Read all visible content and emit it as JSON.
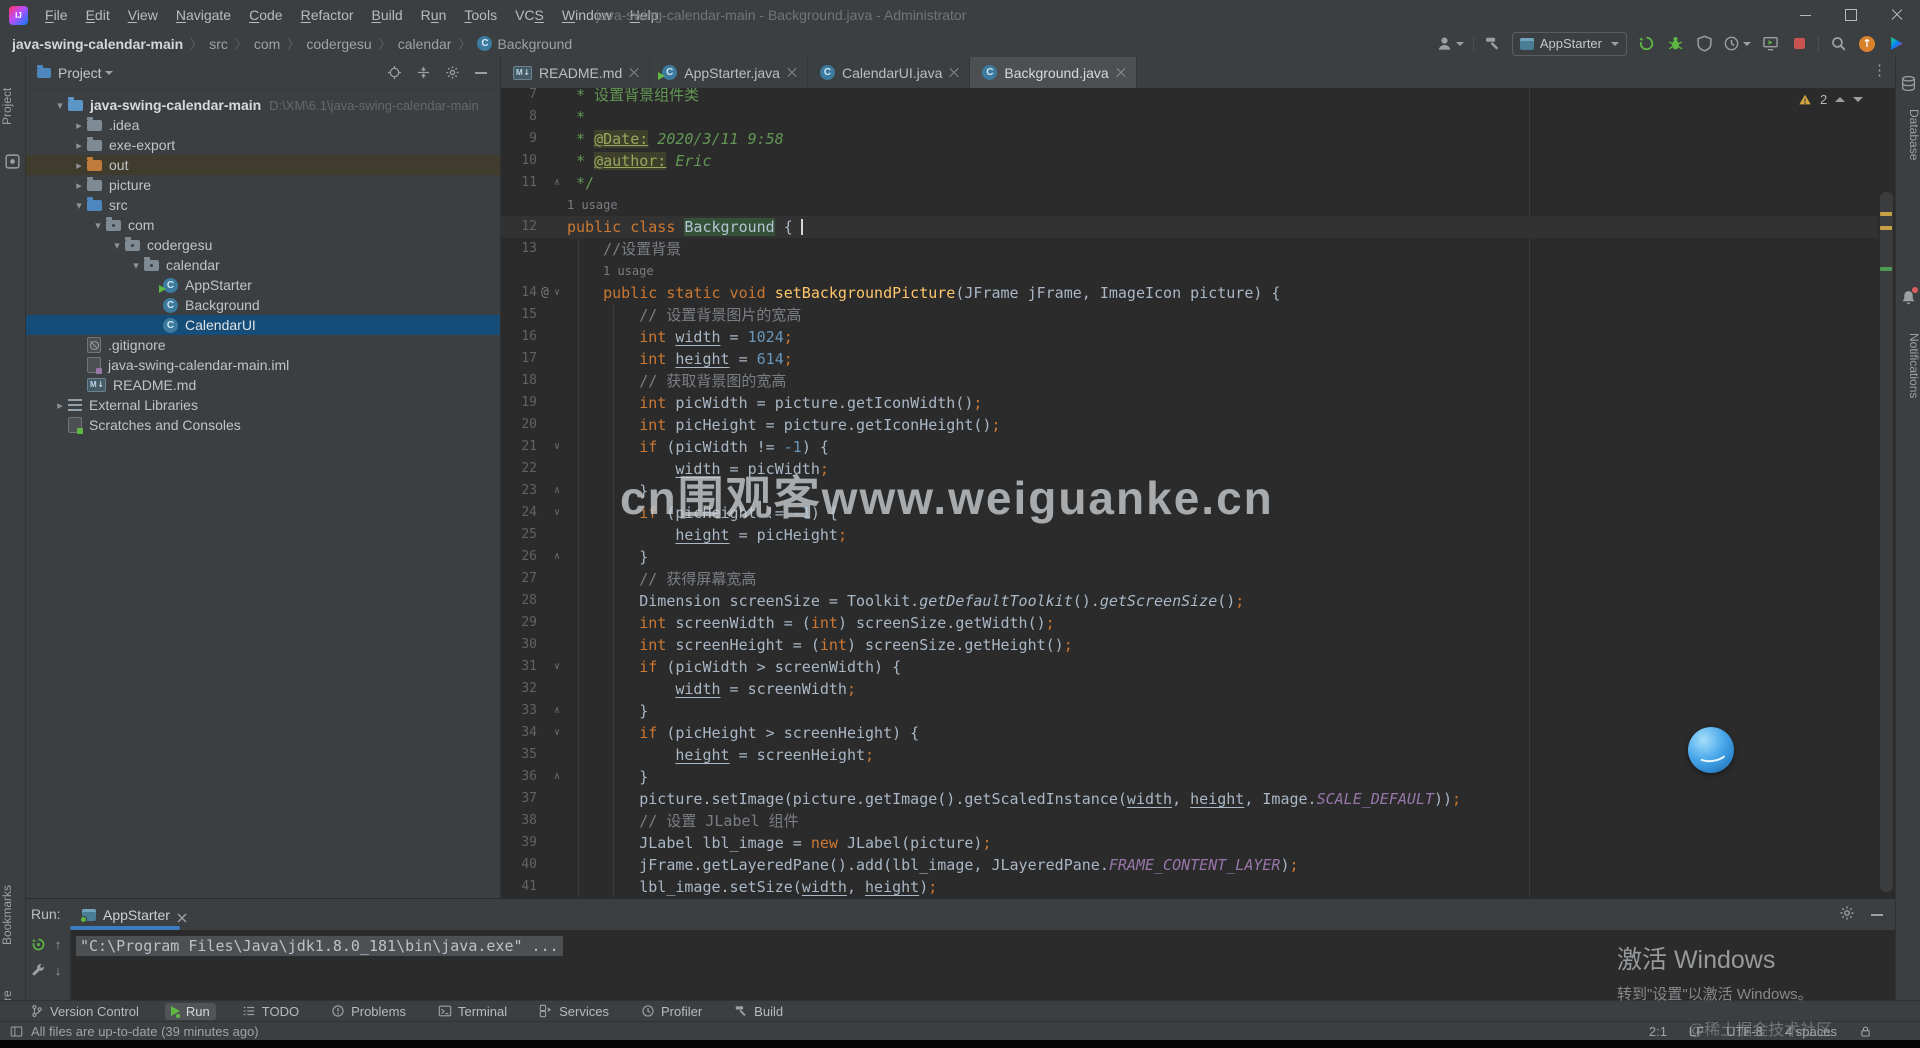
{
  "titlebar": {
    "logo": "IJ",
    "title": "java-swing-calendar-main - Background.java - Administrator",
    "menus": [
      {
        "label": "File",
        "m": 0
      },
      {
        "label": "Edit",
        "m": 0
      },
      {
        "label": "View",
        "m": 0
      },
      {
        "label": "Navigate",
        "m": 0
      },
      {
        "label": "Code",
        "m": 0
      },
      {
        "label": "Refactor",
        "m": 0
      },
      {
        "label": "Build",
        "m": 0
      },
      {
        "label": "Run",
        "m": 1
      },
      {
        "label": "Tools",
        "m": 0
      },
      {
        "label": "VCS",
        "m": 2
      },
      {
        "label": "Window",
        "m": 0
      },
      {
        "label": "Help",
        "m": 0
      }
    ]
  },
  "navbar": {
    "breadcrumb": [
      {
        "label": "java-swing-calendar-main",
        "bold": true
      },
      {
        "label": "src"
      },
      {
        "label": "com"
      },
      {
        "label": "codergesu"
      },
      {
        "label": "calendar"
      },
      {
        "label": "Background",
        "icon": "class"
      }
    ],
    "run_config": "AppStarter"
  },
  "project": {
    "header": "Project",
    "tree": [
      {
        "lvl": 0,
        "chev": "open",
        "icon": "folder-proj",
        "label": "java-swing-calendar-main",
        "extra": "D:\\XM\\6.1\\java-swing-calendar-main",
        "bold": true
      },
      {
        "lvl": 1,
        "chev": "closed",
        "icon": "folder",
        "label": ".idea"
      },
      {
        "lvl": 1,
        "chev": "closed",
        "icon": "folder",
        "label": "exe-export"
      },
      {
        "lvl": 1,
        "chev": "closed",
        "icon": "folder-excl",
        "label": "out",
        "hl": "mod"
      },
      {
        "lvl": 1,
        "chev": "closed",
        "icon": "folder",
        "label": "picture"
      },
      {
        "lvl": 1,
        "chev": "open",
        "icon": "folder-src",
        "label": "src"
      },
      {
        "lvl": 2,
        "chev": "open",
        "icon": "package",
        "label": "com"
      },
      {
        "lvl": 3,
        "chev": "open",
        "icon": "package",
        "label": "codergesu"
      },
      {
        "lvl": 4,
        "chev": "open",
        "icon": "package",
        "label": "calendar"
      },
      {
        "lvl": 5,
        "chev": "none",
        "icon": "class-run",
        "label": "AppStarter"
      },
      {
        "lvl": 5,
        "chev": "none",
        "icon": "class",
        "label": "Background"
      },
      {
        "lvl": 5,
        "chev": "none",
        "icon": "class",
        "label": "CalendarUI",
        "sel": true
      },
      {
        "lvl": 1,
        "chev": "none",
        "icon": "file-ign",
        "label": ".gitignore"
      },
      {
        "lvl": 1,
        "chev": "none",
        "icon": "file-iml",
        "label": "java-swing-calendar-main.iml"
      },
      {
        "lvl": 1,
        "chev": "none",
        "icon": "file-md",
        "label": "README.md"
      },
      {
        "lvl": 0,
        "chev": "closed",
        "icon": "lib",
        "label": "External Libraries"
      },
      {
        "lvl": 0,
        "chev": "none",
        "icon": "file-scr",
        "label": "Scratches and Consoles"
      }
    ]
  },
  "tabs": [
    {
      "label": "README.md",
      "icon": "file-md"
    },
    {
      "label": "AppStarter.java",
      "icon": "class-run"
    },
    {
      "label": "CalendarUI.java",
      "icon": "class"
    },
    {
      "label": "Background.java",
      "icon": "class",
      "active": true
    }
  ],
  "editor": {
    "inspections": "2",
    "lines": [
      {
        "n": "7",
        "seg": [
          [
            "dc",
            " * 设置背景组件类"
          ]
        ]
      },
      {
        "n": "8",
        "seg": [
          [
            "dc",
            " *"
          ]
        ]
      },
      {
        "n": "9",
        "seg": [
          [
            "dc",
            " * "
          ],
          [
            "tag",
            "@Date:"
          ],
          [
            "dci",
            " 2020/3/11 9:58"
          ]
        ]
      },
      {
        "n": "10",
        "seg": [
          [
            "dc",
            " * "
          ],
          [
            "tag",
            "@author:"
          ],
          [
            "dci",
            " Eric"
          ]
        ]
      },
      {
        "n": "11",
        "fold": "close",
        "seg": [
          [
            "dc",
            " */"
          ]
        ]
      },
      {
        "usage": "1 usage",
        "ind": 0
      },
      {
        "n": "12",
        "caret": true,
        "seg": [
          [
            "k",
            "public class "
          ],
          [
            "cl",
            "Background"
          ],
          [
            "d",
            " {"
          ]
        ]
      },
      {
        "n": "13",
        "seg": [
          [
            "c",
            "    //设置背景"
          ]
        ]
      },
      {
        "usage": "1 usage",
        "ind": 4
      },
      {
        "n": "14",
        "at": true,
        "fold": "open",
        "seg": [
          [
            "k",
            "    public static void "
          ],
          [
            "m",
            "setBackgroundPicture"
          ],
          [
            "d",
            "(JFrame jFrame, ImageIcon picture) {"
          ]
        ]
      },
      {
        "n": "15",
        "seg": [
          [
            "c",
            "        // 设置背景图片的宽高"
          ]
        ]
      },
      {
        "n": "16",
        "seg": [
          [
            "k",
            "        int "
          ],
          [
            "u",
            "width"
          ],
          [
            "d",
            " = "
          ],
          [
            "n2",
            "1024"
          ],
          [
            "s",
            ";"
          ]
        ]
      },
      {
        "n": "17",
        "seg": [
          [
            "k",
            "        int "
          ],
          [
            "u",
            "height"
          ],
          [
            "d",
            " = "
          ],
          [
            "n2",
            "614"
          ],
          [
            "s",
            ";"
          ]
        ]
      },
      {
        "n": "18",
        "seg": [
          [
            "c",
            "        // 获取背景图的宽高"
          ]
        ]
      },
      {
        "n": "19",
        "seg": [
          [
            "k",
            "        int "
          ],
          [
            "d",
            "picWidth = picture.getIconWidth()"
          ],
          [
            "s",
            ";"
          ]
        ]
      },
      {
        "n": "20",
        "seg": [
          [
            "k",
            "        int "
          ],
          [
            "d",
            "picHeight = picture.getIconHeight()"
          ],
          [
            "s",
            ";"
          ]
        ]
      },
      {
        "n": "21",
        "fold": "open",
        "seg": [
          [
            "k",
            "        if "
          ],
          [
            "d",
            "(picWidth != "
          ],
          [
            "n2",
            "-1"
          ],
          [
            "d",
            ") {"
          ]
        ]
      },
      {
        "n": "22",
        "seg": [
          [
            "d",
            "            "
          ],
          [
            "u",
            "width"
          ],
          [
            "d",
            " = picWidth"
          ],
          [
            "s",
            ";"
          ]
        ]
      },
      {
        "n": "23",
        "fold": "close",
        "seg": [
          [
            "d",
            "        }"
          ]
        ]
      },
      {
        "n": "24",
        "fold": "open",
        "seg": [
          [
            "k",
            "        if "
          ],
          [
            "d",
            "(picHeight != "
          ],
          [
            "n2",
            "-1"
          ],
          [
            "d",
            ") {"
          ]
        ]
      },
      {
        "n": "25",
        "seg": [
          [
            "d",
            "            "
          ],
          [
            "u",
            "height"
          ],
          [
            "d",
            " = picHeight"
          ],
          [
            "s",
            ";"
          ]
        ]
      },
      {
        "n": "26",
        "fold": "close",
        "seg": [
          [
            "d",
            "        }"
          ]
        ]
      },
      {
        "n": "27",
        "seg": [
          [
            "c",
            "        // 获得屏幕宽高"
          ]
        ]
      },
      {
        "n": "28",
        "seg": [
          [
            "d",
            "        Dimension screenSize = Toolkit."
          ],
          [
            "di",
            "getDefaultToolkit"
          ],
          [
            "d",
            "()."
          ],
          [
            "di",
            "getScreenSize"
          ],
          [
            "d",
            "()"
          ],
          [
            "s",
            ";"
          ]
        ]
      },
      {
        "n": "29",
        "seg": [
          [
            "k",
            "        int "
          ],
          [
            "d",
            "screenWidth = ("
          ],
          [
            "k",
            "int"
          ],
          [
            "d",
            ") screenSize.getWidth()"
          ],
          [
            "s",
            ";"
          ]
        ]
      },
      {
        "n": "30",
        "seg": [
          [
            "k",
            "        int "
          ],
          [
            "d",
            "screenHeight = ("
          ],
          [
            "k",
            "int"
          ],
          [
            "d",
            ") screenSize.getHeight()"
          ],
          [
            "s",
            ";"
          ]
        ]
      },
      {
        "n": "31",
        "fold": "open",
        "seg": [
          [
            "k",
            "        if "
          ],
          [
            "d",
            "(picWidth > screenWidth) {"
          ]
        ]
      },
      {
        "n": "32",
        "seg": [
          [
            "d",
            "            "
          ],
          [
            "u",
            "width"
          ],
          [
            "d",
            " = screenWidth"
          ],
          [
            "s",
            ";"
          ]
        ]
      },
      {
        "n": "33",
        "fold": "close",
        "seg": [
          [
            "d",
            "        }"
          ]
        ]
      },
      {
        "n": "34",
        "fold": "open",
        "seg": [
          [
            "k",
            "        if "
          ],
          [
            "d",
            "(picHeight > screenHeight) {"
          ]
        ]
      },
      {
        "n": "35",
        "seg": [
          [
            "d",
            "            "
          ],
          [
            "u",
            "height"
          ],
          [
            "d",
            " = screenHeight"
          ],
          [
            "s",
            ";"
          ]
        ]
      },
      {
        "n": "36",
        "fold": "close",
        "seg": [
          [
            "d",
            "        }"
          ]
        ]
      },
      {
        "n": "37",
        "seg": [
          [
            "d",
            "        picture.setImage(picture.getImage().getScaledInstance("
          ],
          [
            "u",
            "width"
          ],
          [
            "d",
            ", "
          ],
          [
            "u",
            "height"
          ],
          [
            "d",
            ", Image."
          ],
          [
            "sf",
            "SCALE_DEFAULT"
          ],
          [
            "d",
            "))"
          ],
          [
            "s",
            ";"
          ]
        ]
      },
      {
        "n": "38",
        "seg": [
          [
            "c",
            "        // 设置 JLabel 组件"
          ]
        ]
      },
      {
        "n": "39",
        "seg": [
          [
            "d",
            "        JLabel lbl_image = "
          ],
          [
            "k",
            "new "
          ],
          [
            "d",
            "JLabel(picture)"
          ],
          [
            "s",
            ";"
          ]
        ]
      },
      {
        "n": "40",
        "seg": [
          [
            "d",
            "        jFrame.getLayeredPane().add(lbl_image, JLayeredPane."
          ],
          [
            "sf",
            "FRAME_CONTENT_LAYER"
          ],
          [
            "d",
            ")"
          ],
          [
            "s",
            ";"
          ]
        ]
      },
      {
        "n": "41",
        "seg": [
          [
            "d",
            "        lbl_image.setSize("
          ],
          [
            "u",
            "width"
          ],
          [
            "d",
            ", "
          ],
          [
            "u",
            "height"
          ],
          [
            "d",
            ")"
          ],
          [
            "s",
            ";"
          ]
        ]
      }
    ]
  },
  "run_panel": {
    "label": "Run:",
    "tab": "AppStarter",
    "console": "\"C:\\Program Files\\Java\\jdk1.8.0_181\\bin\\java.exe\" ..."
  },
  "bottom_bar": [
    {
      "label": "Version Control",
      "icon": "branch"
    },
    {
      "label": "Run",
      "icon": "play",
      "active": true
    },
    {
      "label": "TODO",
      "icon": "todo"
    },
    {
      "label": "Problems",
      "icon": "problems"
    },
    {
      "label": "Terminal",
      "icon": "terminal"
    },
    {
      "label": "Services",
      "icon": "services"
    },
    {
      "label": "Profiler",
      "icon": "profiler"
    },
    {
      "label": "Build",
      "icon": "build"
    }
  ],
  "status_bar": {
    "message": "All files are up-to-date (39 minutes ago)",
    "caret": "2:1",
    "line_ending": "LF",
    "encoding": "UTF-8",
    "indent": "4 spaces"
  },
  "stripes": {
    "left_top": "Project",
    "left_mid": "Bookmarks",
    "left_bottom": "Structure",
    "right_top": "Database",
    "right_bottom": "Notifications"
  },
  "overlays": {
    "watermark_center": "cn围观客www.weiguanke.cn",
    "watermark_corner": "@稀土掘金技术社区",
    "activate_title": "激活 Windows",
    "activate_sub": "转到\"设置\"以激活 Windows。"
  }
}
